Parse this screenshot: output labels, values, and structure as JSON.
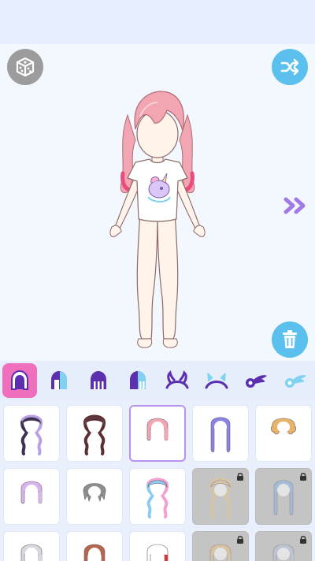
{
  "screen": "hair-dressup",
  "colors": {
    "accent_pink": "#f06fbd",
    "accent_blue": "#5cc0ef",
    "accent_purple": "#7a4fe0",
    "selected_border": "#b693f2"
  },
  "top_actions": [
    {
      "name": "random-dice-button",
      "icon": "dice-icon"
    },
    {
      "name": "shuffle-button",
      "icon": "shuffle-icon"
    }
  ],
  "side_actions": [
    {
      "name": "next-page-button",
      "icon": "double-chevron-right-icon"
    },
    {
      "name": "delete-button",
      "icon": "trash-icon"
    }
  ],
  "categories": [
    {
      "icon": "hair-full-icon",
      "active": true
    },
    {
      "icon": "hair-front-icon",
      "active": false
    },
    {
      "icon": "hair-bangs-icon",
      "active": false
    },
    {
      "icon": "hair-side-icon",
      "active": false
    },
    {
      "icon": "horns-icon",
      "active": false
    },
    {
      "icon": "ears-icon",
      "active": false
    },
    {
      "icon": "wing-left-icon",
      "active": false
    },
    {
      "icon": "wing-right-icon",
      "active": false
    }
  ],
  "hair_items": [
    {
      "style": "long-wavy-twotone",
      "color": "#3c3052",
      "accent": "#b9a0e6",
      "locked": false,
      "selected": false
    },
    {
      "style": "long-wavy",
      "color": "#5a2f32",
      "accent": "#5a2f32",
      "locked": false,
      "selected": false
    },
    {
      "style": "short-bob",
      "color": "#f2a6b2",
      "accent": "#f2a6b2",
      "locked": false,
      "selected": true
    },
    {
      "style": "long-straight",
      "color": "#8a84e6",
      "accent": "#8a84e6",
      "locked": false,
      "selected": false
    },
    {
      "style": "short-curly",
      "color": "#e8b46a",
      "accent": "#e8b46a",
      "locked": false,
      "selected": false
    },
    {
      "style": "short-bob",
      "color": "#d7b4ec",
      "accent": "#d7b4ec",
      "locked": false,
      "selected": false
    },
    {
      "style": "short-messy",
      "color": "#8d8d8d",
      "accent": "#8d8d8d",
      "locked": false,
      "selected": false
    },
    {
      "style": "long-wavy-twotone",
      "color": "#8ecbf2",
      "accent": "#f2a0d0",
      "locked": false,
      "selected": false
    },
    {
      "style": "long-wavy",
      "color": "#e6c48e",
      "accent": "#e6c48e",
      "locked": true,
      "selected": false
    },
    {
      "style": "long-straight",
      "color": "#8bb6e8",
      "accent": "#8bb6e8",
      "locked": true,
      "selected": false
    },
    {
      "style": "short-bob",
      "color": "#d8d8de",
      "accent": "#d8d8de",
      "locked": false,
      "selected": false
    },
    {
      "style": "short-bob",
      "color": "#b5654c",
      "accent": "#b5654c",
      "locked": false,
      "selected": false
    },
    {
      "style": "short-bob",
      "color": "#ffffff",
      "accent": "#d23a3a",
      "locked": false,
      "selected": false
    },
    {
      "style": "short-bob",
      "color": "#e8c28e",
      "accent": "#e8c28e",
      "locked": true,
      "selected": false
    },
    {
      "style": "short-bob",
      "color": "#b8c4dc",
      "accent": "#b8c4dc",
      "locked": true,
      "selected": false
    }
  ]
}
